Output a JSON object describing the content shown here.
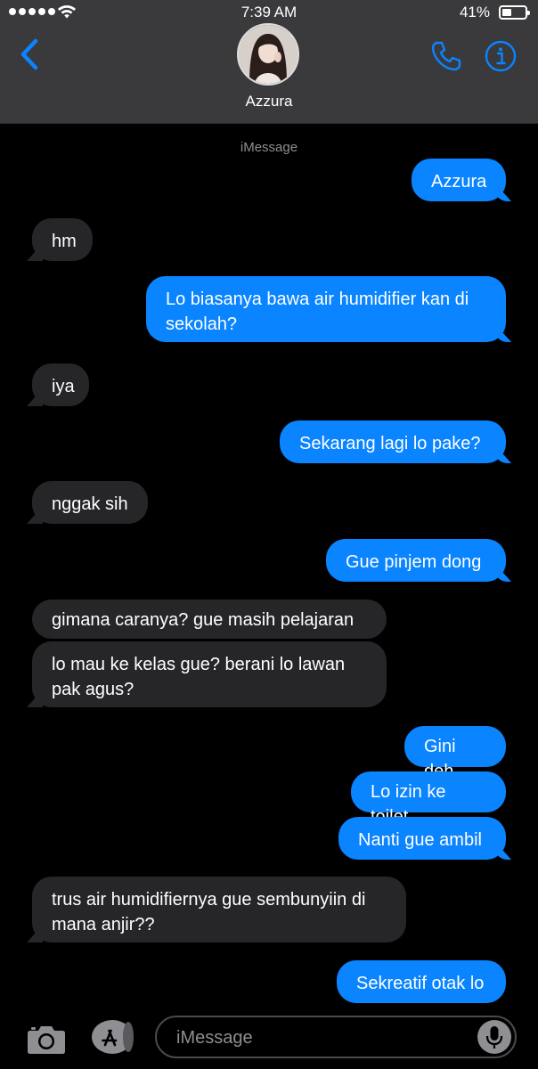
{
  "status": {
    "time": "7:39 AM",
    "battery_percent": "41%",
    "battery_level": 0.41,
    "signal_dots": 5
  },
  "contact": {
    "name": "Azzura"
  },
  "service_label": "iMessage",
  "messages": [
    {
      "from": "me",
      "text": "Azzura"
    },
    {
      "from": "them",
      "text": "hm"
    },
    {
      "from": "me",
      "text": "Lo biasanya bawa air humidifier kan di sekolah?"
    },
    {
      "from": "them",
      "text": "iya"
    },
    {
      "from": "me",
      "text": "Sekarang lagi lo pake?"
    },
    {
      "from": "them",
      "text": "nggak sih"
    },
    {
      "from": "me",
      "text": "Gue pinjem dong"
    },
    {
      "from": "them",
      "text": "gimana caranya? gue masih pelajaran"
    },
    {
      "from": "them",
      "text": "lo mau ke kelas gue? berani lo lawan pak agus?"
    },
    {
      "from": "me",
      "text": "Gini deh"
    },
    {
      "from": "me",
      "text": "Lo izin ke toilet"
    },
    {
      "from": "me",
      "text": "Nanti gue ambil"
    },
    {
      "from": "them",
      "text": "trus air humidifiernya gue sembunyiin di mana anjir??"
    },
    {
      "from": "me",
      "text": "Sekreatif otak lo"
    }
  ],
  "input": {
    "placeholder": "iMessage",
    "value": ""
  },
  "colors": {
    "outgoing_bubble": "#0a84ff",
    "incoming_bubble": "#262629",
    "header_bg": "#3a3a3c",
    "accent": "#0a84ff"
  },
  "icons": {
    "back": "chevron-left-icon",
    "call": "phone-icon",
    "info": "info-icon",
    "camera": "camera-icon",
    "apps": "app-store-icon",
    "mic": "microphone-icon"
  }
}
